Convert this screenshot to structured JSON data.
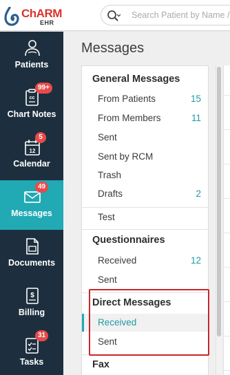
{
  "brand": {
    "name": "ChARM",
    "sub": "EHR"
  },
  "search": {
    "placeholder": "Search Patient by Name / ID"
  },
  "sidebar": {
    "items": [
      {
        "label": "Patients",
        "icon": "patients-icon",
        "badge": ""
      },
      {
        "label": "Chart Notes",
        "icon": "chart-notes-icon",
        "badge": "99+"
      },
      {
        "label": "Calendar",
        "icon": "calendar-icon",
        "badge": "5"
      },
      {
        "label": "Messages",
        "icon": "envelope-icon",
        "badge": "49",
        "active": true
      },
      {
        "label": "Documents",
        "icon": "documents-icon",
        "badge": ""
      },
      {
        "label": "Billing",
        "icon": "billing-icon",
        "badge": ""
      },
      {
        "label": "Tasks",
        "icon": "tasks-icon",
        "badge": "31"
      }
    ]
  },
  "main": {
    "title": "Messages",
    "sections": {
      "general": {
        "title": "General Messages",
        "items": [
          {
            "label": "From Patients",
            "count": "15"
          },
          {
            "label": "From Members",
            "count": "11"
          },
          {
            "label": "Sent",
            "count": ""
          },
          {
            "label": "Sent by RCM",
            "count": ""
          },
          {
            "label": "Trash",
            "count": ""
          },
          {
            "label": "Drafts",
            "count": "2"
          }
        ]
      },
      "other": {
        "items": [
          {
            "label": "Test",
            "count": ""
          }
        ]
      },
      "questionnaires": {
        "title": "Questionnaires",
        "items": [
          {
            "label": "Received",
            "count": "12"
          },
          {
            "label": "Sent",
            "count": ""
          }
        ]
      },
      "direct": {
        "title": "Direct Messages",
        "items": [
          {
            "label": "Received",
            "count": "",
            "selected": true
          },
          {
            "label": "Sent",
            "count": ""
          }
        ]
      },
      "fax": {
        "title": "Fax"
      }
    }
  },
  "colors": {
    "sidebar_bg": "#1d2f3e",
    "accent": "#21a9b4",
    "badge": "#e84a4a",
    "count": "#1f9aa6",
    "annotation_box": "#c9252b",
    "brand_red": "#d8342c"
  }
}
